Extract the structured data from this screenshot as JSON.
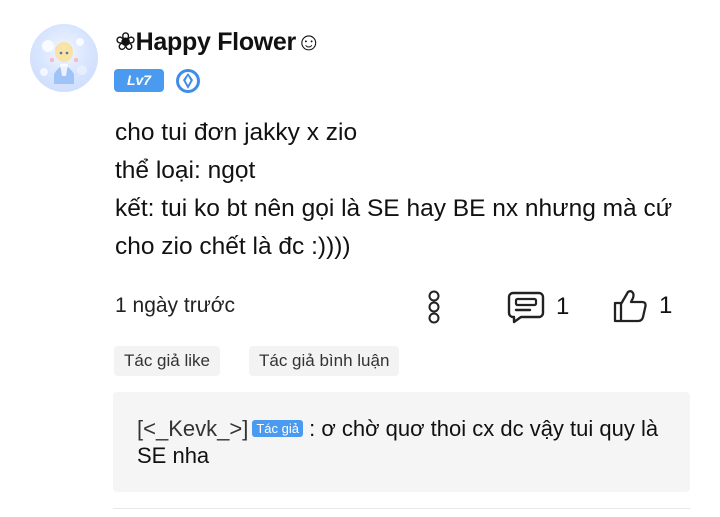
{
  "comment": {
    "user": {
      "name": "❀Happy Flower☺",
      "level": "Lv7",
      "avatar_icon": "avatar-icon",
      "rank_icon": "rank-badge-icon"
    },
    "body_lines": [
      "cho tui đơn jakky x zio",
      "thể loại: ngọt",
      "kết: tui ko bt nên gọi là SE hay BE nx nhưng mà cứ",
      "cho zio chết là đc :))))"
    ],
    "timestamp": "1 ngày trước",
    "reply_count": "1",
    "like_count": "1",
    "tags": [
      "Tác giả like",
      "Tác giả bình luận"
    ],
    "reply": {
      "author": "[<_Kevk_>]",
      "author_badge": "Tác giả",
      "separator": ":",
      "text": "ơ chờ quơ thoi cx dc vậy tui quy là SE nha"
    }
  },
  "colors": {
    "accent": "#4a9af0",
    "background": "#ffffff",
    "reply_background": "#f5f5f5",
    "tag_background": "#f3f3f3"
  }
}
